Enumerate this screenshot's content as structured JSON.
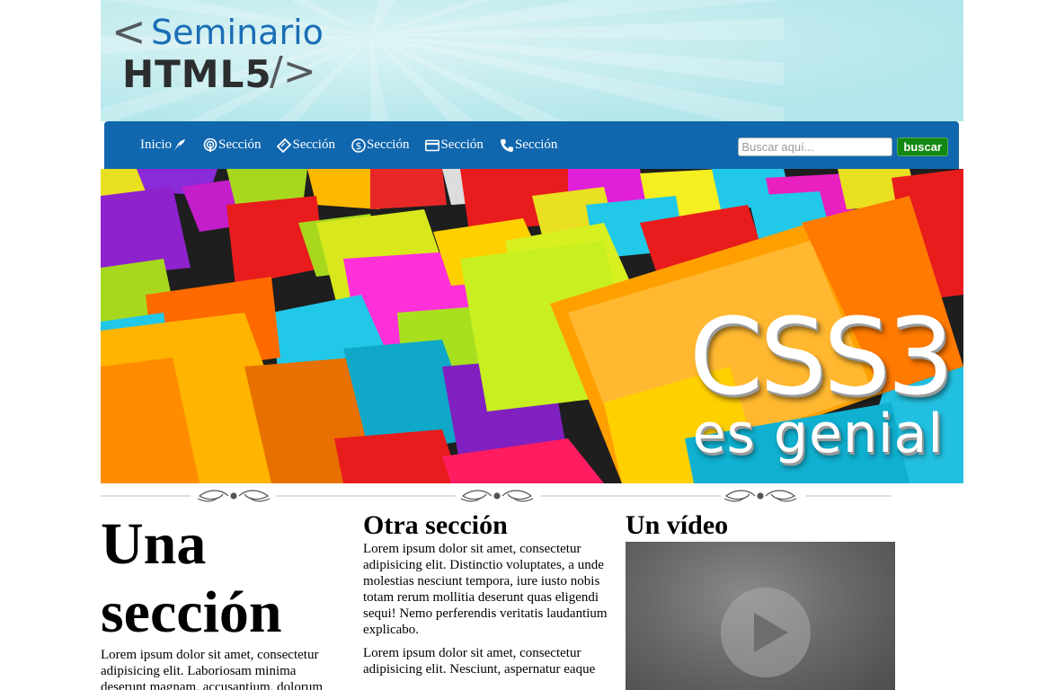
{
  "header": {
    "logo": {
      "line1_prefix": "<",
      "line1": "Seminario",
      "line2": "HTML5",
      "line2_suffix": "/>"
    }
  },
  "nav": {
    "items": [
      {
        "label": "Inicio",
        "icon": "feather-icon"
      },
      {
        "label": "Sección",
        "icon": "podcast-icon"
      },
      {
        "label": "Sección",
        "icon": "ticket-icon"
      },
      {
        "label": "Sección",
        "icon": "dollar-icon"
      },
      {
        "label": "Sección",
        "icon": "credit-card-icon"
      },
      {
        "label": "Sección",
        "icon": "phone-icon"
      }
    ],
    "search": {
      "placeholder": "Buscar aquí...",
      "button_label": "buscar"
    }
  },
  "banner": {
    "title": "CSS3",
    "subtitle": "es genial"
  },
  "columns": {
    "col1": {
      "title": "Una sección",
      "paragraph": "Lorem ipsum dolor sit amet, consectetur adipisicing elit. Laboriosam minima deserunt magnam, accusantium, dolorum"
    },
    "col2": {
      "title": "Otra sección",
      "paragraph1": "Lorem ipsum dolor sit amet, consectetur adipisicing elit. Distinctio voluptates, a unde molestias nesciunt tempora, iure iusto nobis totam rerum mollitia deserunt quas eligendi sequi! Nemo perferendis veritatis laudantium explicabo.",
      "paragraph2": "Lorem ipsum dolor sit amet, consectetur adipisicing elit. Nesciunt, aspernatur eaque"
    },
    "col3": {
      "title": "Un vídeo",
      "video_icon": "play-icon"
    }
  },
  "colors": {
    "header_bg": "#b3e6ea",
    "nav_bg": "#1167ae",
    "logo_blue": "#1a6eb5",
    "logo_dark": "#2b2d2e",
    "search_button": "#118811"
  }
}
